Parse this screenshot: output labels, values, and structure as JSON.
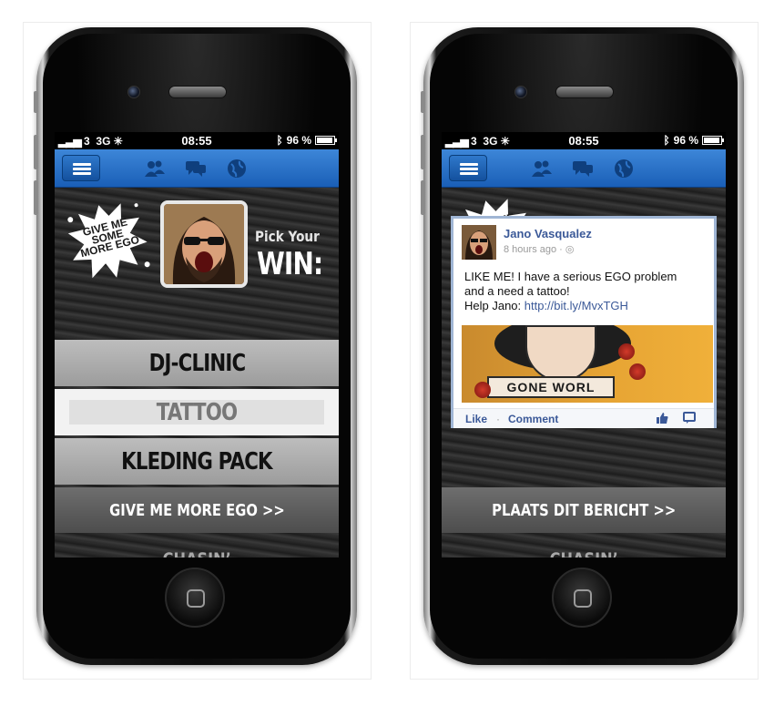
{
  "status_bar": {
    "carrier": "3",
    "network": "3G",
    "time": "08:55",
    "battery": "96 %",
    "battery_level": 0.96
  },
  "left_screen": {
    "badge_text": "GIVE ME SOME MORE EGO",
    "pick_line1": "Pick Your",
    "pick_line2": "WIN:",
    "options": [
      {
        "label": "DJ-CLINIC",
        "selected": false
      },
      {
        "label": "TATTOO",
        "selected": true
      },
      {
        "label": "KLEDING PACK",
        "selected": false
      }
    ],
    "cta_label": "GIVE ME MORE EGO >>",
    "footer_brand": "CHASIN’"
  },
  "right_screen": {
    "post": {
      "author": "Jano Vasqualez",
      "time": "8 hours ago",
      "line1": "LIKE ME! I have a serious EGO problem",
      "line2": "and a need a tattoo!",
      "line3_prefix": "Help Jano: ",
      "link": "http://bit.ly/MvxTGH",
      "image_text": "GONE WORL",
      "like_label": "Like",
      "separator": "·",
      "comment_label": "Comment"
    },
    "cta_label": "PLAATS DIT BERICHT >>",
    "footer_brand": "CHASIN’"
  },
  "colors": {
    "nav_blue": "#2a6fc6",
    "fb_link": "#3b5998",
    "cta_gray": "#5d5d5d"
  },
  "icons": [
    "menu-icon",
    "friends-icon",
    "messages-icon",
    "globe-icon",
    "bluetooth-icon",
    "battery-icon",
    "thumbs-up-icon",
    "comment-bubble-icon"
  ]
}
